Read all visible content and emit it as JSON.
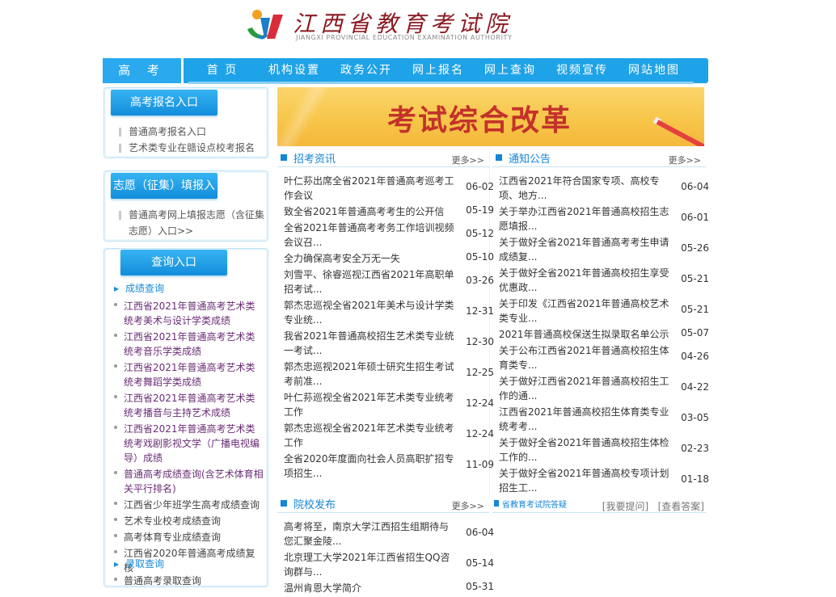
{
  "header": {
    "logo_cn": "江西省教育考试院",
    "logo_en": "JIANGXI PROVINCIAL EDUCATION EXAMINATION AUTHORITY"
  },
  "nav": {
    "site": "高 考",
    "items": [
      "首 页",
      "机构设置",
      "政务公开",
      "网上报名",
      "网上查询",
      "视频宣传",
      "网站地图"
    ]
  },
  "colors": {
    "nav_blue": "#1fa3e8",
    "accent_blue": "#1585d6",
    "banner_yellow": "#f7c64a",
    "banner_red": "#c3322a",
    "link_purple": "#6a2d76"
  },
  "panel1": {
    "title": "高考报名入口",
    "items": [
      "普通高考报名入口",
      "艺术类专业在赣设点校考报名"
    ]
  },
  "panel2": {
    "title": "志愿（征集）填报入口",
    "items": [
      "普通高考网上填报志愿（含征集志愿）入口>>"
    ]
  },
  "panel3": {
    "title": "查询入口",
    "sub1": "成绩查询",
    "sub2": "录取查询",
    "scores": [
      "江西省2021年普通高考艺术类统考美术与设计学类成绩",
      "江西省2021年普通高考艺术类统考音乐学类成绩",
      "江西省2021年普通高考艺术类统考舞蹈学类成绩",
      "江西省2021年普通高考艺术类统考播音与主持艺术成绩",
      "江西省2021年普通高考艺术类统考戏剧影视文学（广播电视编导）成绩",
      "普通高考成绩查询(含艺术体育相关平行排名)",
      "江西省少年班学生高考成绩查询",
      "艺术专业校考成绩查询",
      "高考体育专业成绩查询",
      "江西省2020年普通高考成绩复核"
    ],
    "admission": [
      "普通高考录取查询"
    ]
  },
  "banner": {
    "text": "考试综合改革"
  },
  "zhaokao": {
    "title": "招考资讯",
    "more": "更多>>",
    "items": [
      {
        "t": "叶仁荪出席全省2021年普通高考巡考工作会议",
        "d": "06-02"
      },
      {
        "t": "致全省2021年普通高考考生的公开信",
        "d": "05-19"
      },
      {
        "t": "全省2021年普通高考考务工作培训视频会议召...",
        "d": "05-12"
      },
      {
        "t": "全力确保高考安全万无一失",
        "d": "05-10"
      },
      {
        "t": "刘雪平、徐睿巡视江西省2021年高职单招考试...",
        "d": "03-26"
      },
      {
        "t": "郭杰忠巡视全省2021年美术与设计学类专业统...",
        "d": "12-31"
      },
      {
        "t": "我省2021年普通高校招生艺术类专业统一考试...",
        "d": "12-30"
      },
      {
        "t": "郭杰忠巡视2021年硕士研究生招生考试考前准...",
        "d": "12-25"
      },
      {
        "t": "叶仁荪巡视全省2021年艺术类专业统考工作",
        "d": "12-24"
      },
      {
        "t": "郭杰忠巡视全省2021年艺术类专业统考工作",
        "d": "12-24"
      },
      {
        "t": "全省2020年度面向社会人员高职扩招专项招生...",
        "d": "11-09"
      }
    ]
  },
  "tongzhi": {
    "title": "通知公告",
    "more": "更多>>",
    "items": [
      {
        "t": "江西省2021年符合国家专项、高校专项、地方...",
        "d": "06-04"
      },
      {
        "t": "关于举办江西省2021年普通高校招生志愿填报...",
        "d": "06-01"
      },
      {
        "t": "关于做好全省2021年普通高考考生申请成绩复...",
        "d": "05-26"
      },
      {
        "t": "关于做好全省2021年普通高校招生享受优惠政...",
        "d": "05-21"
      },
      {
        "t": "关于印发《江西省2021年普通高校艺术类专业...",
        "d": "05-21"
      },
      {
        "t": "2021年普通高校保送生拟录取名单公示",
        "d": "05-07"
      },
      {
        "t": "关于公布江西省2021年普通高校招生体育类专...",
        "d": "04-26"
      },
      {
        "t": "关于做好江西省2021年普通高校招生工作的通...",
        "d": "04-22"
      },
      {
        "t": "江西省2021年普通高校招生体育类专业统考考...",
        "d": "03-05"
      },
      {
        "t": "关于做好全省2021年普通高校招生体检工作的...",
        "d": "02-23"
      },
      {
        "t": "关于做好全省2021年普通高校专项计划招生工...",
        "d": "01-18"
      }
    ]
  },
  "yuanxiao": {
    "title": "院校发布",
    "more": "更多>>",
    "items": [
      {
        "t": "高考将至，南京大学江西招生组期待与您汇聚金陵...",
        "d": "06-04"
      },
      {
        "t": "北京理工大学2021年江西省招生QQ咨询群与...",
        "d": "05-14"
      },
      {
        "t": "温州肯恩大学简介",
        "d": "05-31"
      }
    ]
  },
  "gaokao_qa": {
    "label": "省教育考试院答疑",
    "ask": "[我要提问]",
    "view": "[查看答案]"
  }
}
